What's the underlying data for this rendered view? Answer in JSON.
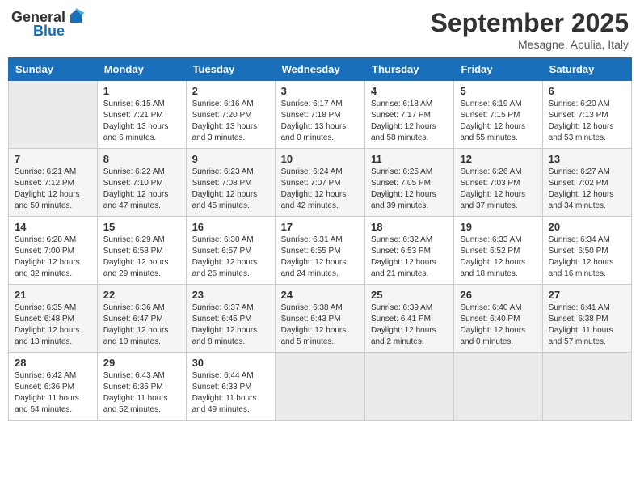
{
  "header": {
    "logo_general": "General",
    "logo_blue": "Blue",
    "month_title": "September 2025",
    "location": "Mesagne, Apulia, Italy"
  },
  "columns": [
    "Sunday",
    "Monday",
    "Tuesday",
    "Wednesday",
    "Thursday",
    "Friday",
    "Saturday"
  ],
  "weeks": [
    [
      {
        "day": "",
        "sunrise": "",
        "sunset": "",
        "daylight": ""
      },
      {
        "day": "1",
        "sunrise": "Sunrise: 6:15 AM",
        "sunset": "Sunset: 7:21 PM",
        "daylight": "Daylight: 13 hours and 6 minutes."
      },
      {
        "day": "2",
        "sunrise": "Sunrise: 6:16 AM",
        "sunset": "Sunset: 7:20 PM",
        "daylight": "Daylight: 13 hours and 3 minutes."
      },
      {
        "day": "3",
        "sunrise": "Sunrise: 6:17 AM",
        "sunset": "Sunset: 7:18 PM",
        "daylight": "Daylight: 13 hours and 0 minutes."
      },
      {
        "day": "4",
        "sunrise": "Sunrise: 6:18 AM",
        "sunset": "Sunset: 7:17 PM",
        "daylight": "Daylight: 12 hours and 58 minutes."
      },
      {
        "day": "5",
        "sunrise": "Sunrise: 6:19 AM",
        "sunset": "Sunset: 7:15 PM",
        "daylight": "Daylight: 12 hours and 55 minutes."
      },
      {
        "day": "6",
        "sunrise": "Sunrise: 6:20 AM",
        "sunset": "Sunset: 7:13 PM",
        "daylight": "Daylight: 12 hours and 53 minutes."
      }
    ],
    [
      {
        "day": "7",
        "sunrise": "Sunrise: 6:21 AM",
        "sunset": "Sunset: 7:12 PM",
        "daylight": "Daylight: 12 hours and 50 minutes."
      },
      {
        "day": "8",
        "sunrise": "Sunrise: 6:22 AM",
        "sunset": "Sunset: 7:10 PM",
        "daylight": "Daylight: 12 hours and 47 minutes."
      },
      {
        "day": "9",
        "sunrise": "Sunrise: 6:23 AM",
        "sunset": "Sunset: 7:08 PM",
        "daylight": "Daylight: 12 hours and 45 minutes."
      },
      {
        "day": "10",
        "sunrise": "Sunrise: 6:24 AM",
        "sunset": "Sunset: 7:07 PM",
        "daylight": "Daylight: 12 hours and 42 minutes."
      },
      {
        "day": "11",
        "sunrise": "Sunrise: 6:25 AM",
        "sunset": "Sunset: 7:05 PM",
        "daylight": "Daylight: 12 hours and 39 minutes."
      },
      {
        "day": "12",
        "sunrise": "Sunrise: 6:26 AM",
        "sunset": "Sunset: 7:03 PM",
        "daylight": "Daylight: 12 hours and 37 minutes."
      },
      {
        "day": "13",
        "sunrise": "Sunrise: 6:27 AM",
        "sunset": "Sunset: 7:02 PM",
        "daylight": "Daylight: 12 hours and 34 minutes."
      }
    ],
    [
      {
        "day": "14",
        "sunrise": "Sunrise: 6:28 AM",
        "sunset": "Sunset: 7:00 PM",
        "daylight": "Daylight: 12 hours and 32 minutes."
      },
      {
        "day": "15",
        "sunrise": "Sunrise: 6:29 AM",
        "sunset": "Sunset: 6:58 PM",
        "daylight": "Daylight: 12 hours and 29 minutes."
      },
      {
        "day": "16",
        "sunrise": "Sunrise: 6:30 AM",
        "sunset": "Sunset: 6:57 PM",
        "daylight": "Daylight: 12 hours and 26 minutes."
      },
      {
        "day": "17",
        "sunrise": "Sunrise: 6:31 AM",
        "sunset": "Sunset: 6:55 PM",
        "daylight": "Daylight: 12 hours and 24 minutes."
      },
      {
        "day": "18",
        "sunrise": "Sunrise: 6:32 AM",
        "sunset": "Sunset: 6:53 PM",
        "daylight": "Daylight: 12 hours and 21 minutes."
      },
      {
        "day": "19",
        "sunrise": "Sunrise: 6:33 AM",
        "sunset": "Sunset: 6:52 PM",
        "daylight": "Daylight: 12 hours and 18 minutes."
      },
      {
        "day": "20",
        "sunrise": "Sunrise: 6:34 AM",
        "sunset": "Sunset: 6:50 PM",
        "daylight": "Daylight: 12 hours and 16 minutes."
      }
    ],
    [
      {
        "day": "21",
        "sunrise": "Sunrise: 6:35 AM",
        "sunset": "Sunset: 6:48 PM",
        "daylight": "Daylight: 12 hours and 13 minutes."
      },
      {
        "day": "22",
        "sunrise": "Sunrise: 6:36 AM",
        "sunset": "Sunset: 6:47 PM",
        "daylight": "Daylight: 12 hours and 10 minutes."
      },
      {
        "day": "23",
        "sunrise": "Sunrise: 6:37 AM",
        "sunset": "Sunset: 6:45 PM",
        "daylight": "Daylight: 12 hours and 8 minutes."
      },
      {
        "day": "24",
        "sunrise": "Sunrise: 6:38 AM",
        "sunset": "Sunset: 6:43 PM",
        "daylight": "Daylight: 12 hours and 5 minutes."
      },
      {
        "day": "25",
        "sunrise": "Sunrise: 6:39 AM",
        "sunset": "Sunset: 6:41 PM",
        "daylight": "Daylight: 12 hours and 2 minutes."
      },
      {
        "day": "26",
        "sunrise": "Sunrise: 6:40 AM",
        "sunset": "Sunset: 6:40 PM",
        "daylight": "Daylight: 12 hours and 0 minutes."
      },
      {
        "day": "27",
        "sunrise": "Sunrise: 6:41 AM",
        "sunset": "Sunset: 6:38 PM",
        "daylight": "Daylight: 11 hours and 57 minutes."
      }
    ],
    [
      {
        "day": "28",
        "sunrise": "Sunrise: 6:42 AM",
        "sunset": "Sunset: 6:36 PM",
        "daylight": "Daylight: 11 hours and 54 minutes."
      },
      {
        "day": "29",
        "sunrise": "Sunrise: 6:43 AM",
        "sunset": "Sunset: 6:35 PM",
        "daylight": "Daylight: 11 hours and 52 minutes."
      },
      {
        "day": "30",
        "sunrise": "Sunrise: 6:44 AM",
        "sunset": "Sunset: 6:33 PM",
        "daylight": "Daylight: 11 hours and 49 minutes."
      },
      {
        "day": "",
        "sunrise": "",
        "sunset": "",
        "daylight": ""
      },
      {
        "day": "",
        "sunrise": "",
        "sunset": "",
        "daylight": ""
      },
      {
        "day": "",
        "sunrise": "",
        "sunset": "",
        "daylight": ""
      },
      {
        "day": "",
        "sunrise": "",
        "sunset": "",
        "daylight": ""
      }
    ]
  ]
}
